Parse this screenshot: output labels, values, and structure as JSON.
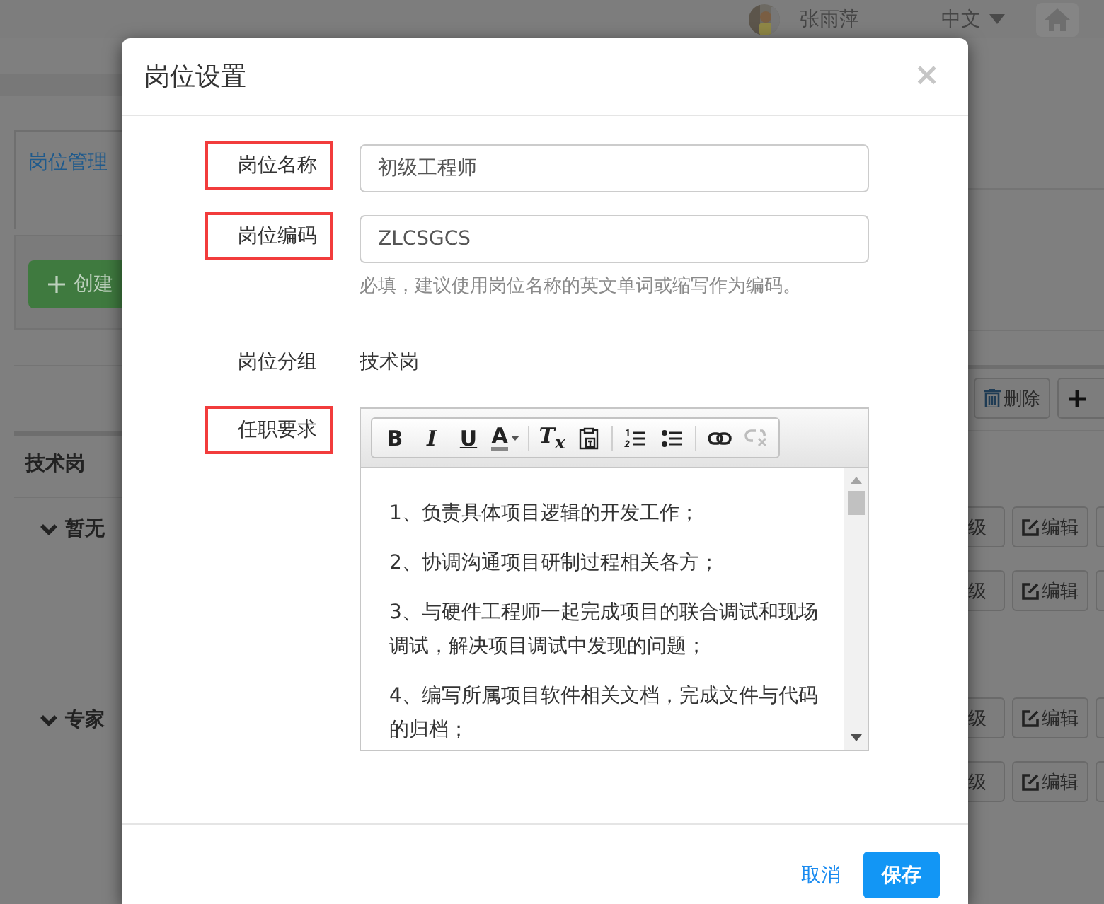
{
  "top_bar": {
    "user_name": "张雨萍",
    "language": "中文"
  },
  "left_panel": {
    "tab": "岗位管理",
    "create_button": "创建",
    "group_title": "技术岗",
    "sections": [
      "暂无",
      "专家"
    ]
  },
  "right_panel": {
    "delete_button": "删除",
    "rows": [
      {
        "level_button": "级",
        "edit_button": "编辑"
      },
      {
        "level_button": "级",
        "edit_button": "编辑"
      },
      {
        "level_button": "级",
        "edit_button": "编辑"
      },
      {
        "level_button": "级",
        "edit_button": "编辑"
      }
    ]
  },
  "dialog": {
    "title": "岗位设置",
    "close": "×",
    "fields": [
      {
        "kind": "input",
        "label": "岗位名称",
        "highlighted": true,
        "value": "初级工程师"
      },
      {
        "kind": "input",
        "label": "岗位编码",
        "highlighted": true,
        "value": "ZLCSGCS",
        "help": "必填，建议使用岗位名称的英文单词或缩写作为编码。"
      },
      {
        "kind": "static",
        "label": "岗位分组",
        "highlighted": false,
        "value": "技术岗"
      },
      {
        "kind": "editor",
        "label": "任职要求",
        "highlighted": true,
        "toolbar": [
          [
            {
              "kind": "bold",
              "label": "B",
              "disabled": false
            },
            {
              "kind": "italic",
              "label": "I",
              "disabled": false
            },
            {
              "kind": "underline",
              "label": "U",
              "disabled": false
            },
            {
              "kind": "text-color",
              "label": "A",
              "disabled": false
            }
          ],
          [
            {
              "kind": "clear-format",
              "label": "T$_{x}$",
              "disabled": false
            },
            {
              "kind": "paste",
              "disabled": false
            }
          ],
          [
            {
              "kind": "ordered-list",
              "disabled": false
            },
            {
              "kind": "bullet-list",
              "disabled": false
            }
          ],
          [
            {
              "kind": "link",
              "disabled": false
            },
            {
              "kind": "unlink",
              "disabled": true
            }
          ]
        ],
        "paragraphs": [
          "1、负责具体项目逻辑的开发工作；",
          "2、协调沟通项目研制过程相关各方；",
          "3、与硬件工程师一起完成项目的联合调试和现场调试，解决项目调试中发现的问题；",
          "4、编写所属项目软件相关文档，完成文件与代码的归档；"
        ]
      }
    ],
    "cancel_button": "取消",
    "save_button": "保存"
  }
}
